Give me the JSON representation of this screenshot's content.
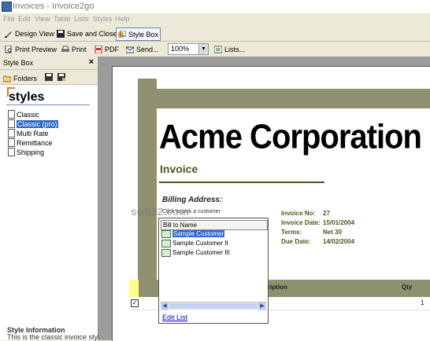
{
  "window": {
    "title": "Invoices - Invoice2go"
  },
  "menu": [
    "File",
    "Edit",
    "View",
    "Table",
    "Lists",
    "Styles",
    "Help"
  ],
  "toolbar1": {
    "design_view": "Design View",
    "save_close": "Save and Close",
    "style_box": "Style Box"
  },
  "toolbar2": {
    "print_preview": "Print Preview",
    "print": "Print",
    "pdf": "PDF",
    "send": "Send...",
    "zoom": "100%",
    "lists": "Lists..."
  },
  "stylebox": {
    "title": "Style Box",
    "close": "×",
    "folders": "Folders",
    "logo": "styles",
    "items": [
      "Classic",
      "Classic (pro)",
      "Multi Rate",
      "Remittance",
      "Shipping"
    ],
    "selected_index": 1,
    "info_title": "Style Information",
    "info_text": "This is the classic invoice style for"
  },
  "invoice": {
    "company": "Acme Corporation",
    "title": "Invoice",
    "billing_label": "Billing Address:",
    "click_hint": "Click to pick a customer",
    "meta": [
      {
        "label": "Invoice No:",
        "value": "27"
      },
      {
        "label": "Invoice Date:",
        "value": "15/01/2004"
      },
      {
        "label": "Terms:",
        "value": "Net  30"
      },
      {
        "label": "Due Date:",
        "value": "14/02/2004"
      }
    ],
    "table_headers": {
      "description": "ription",
      "qty": "Qty"
    },
    "row_qty": "1",
    "row_check": "✓"
  },
  "popup": {
    "header": "Bill to Name",
    "items": [
      "Sample Customer",
      "Sample Customer II",
      "Sample Customer III"
    ],
    "selected_index": 0,
    "edit_list": "Edit List"
  },
  "watermark": "soft32.com",
  "colors": {
    "band": "#8f9070",
    "accent": "#55531f",
    "selection": "#316ac5"
  }
}
